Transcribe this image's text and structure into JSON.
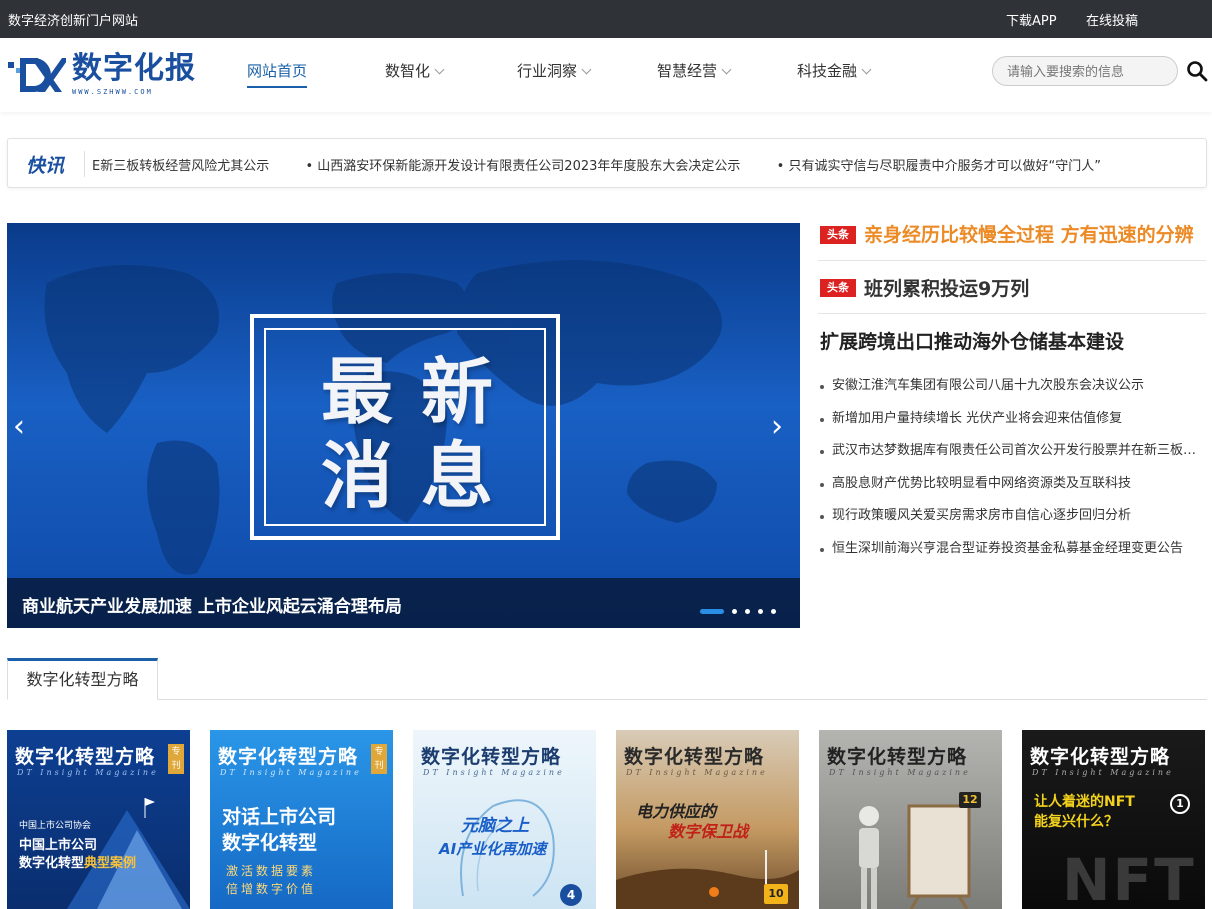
{
  "topbar": {
    "site_desc": "数字经济创新门户网站",
    "download_app": "下载APP",
    "submit_online": "在线投稿"
  },
  "header": {
    "logo_text": "数字化报",
    "logo_url": "WWW.SZHWW.COM",
    "nav": [
      {
        "label": "网站首页",
        "active": true
      },
      {
        "label": "数智化",
        "dropdown": true
      },
      {
        "label": "行业洞察",
        "dropdown": true
      },
      {
        "label": "智慧经营",
        "dropdown": true
      },
      {
        "label": "科技金融",
        "dropdown": true
      }
    ],
    "search_placeholder": "请输入要搜索的信息",
    "search_icon": "search-icon"
  },
  "ticker": {
    "badge": "快讯",
    "items": [
      "E新三板转板经营风险尤其公示",
      "• 山西潞安环保新能源开发设计有限责任公司2023年年度股东大会决定公示",
      "• 只有诚实守信与尽职履责中介服务才可以做好“守门人”"
    ]
  },
  "carousel": {
    "image_text_line1": "最新",
    "image_text_line2": "消息",
    "caption": "商业航天产业发展加速 上市企业风起云涌合理布局",
    "slide_count": 5,
    "active_slide": 1,
    "prev_icon": "‹",
    "next_icon": "›",
    "bg_color": "#0e49a6"
  },
  "headlines": {
    "tag": "头条",
    "top1": "亲身经历比较慢全过程 方有迅速的分辨",
    "top2": "班列累积投运9万列",
    "top3": "扩展跨境出口推动海外仓储基本建设",
    "list": [
      "安徽江淮汽车集团有限公司八届十九次股东会决议公示",
      "新增加用户量持续增长 光伏产业将会迎来估值修复",
      "武汉市达梦数据库有限责任公司首次公开发行股票并在新三板上市",
      "高股息财产优势比较明显看中网络资源类及互联科技",
      "现行政策暖风关爱买房需求房市自信心逐步回归分析",
      "恒生深圳前海兴亨混合型证券投资基金私募基金经理变更公告"
    ],
    "accent_color": "#ec8a25"
  },
  "section": {
    "tab_label": "数字化转型方略"
  },
  "magazines": [
    {
      "title": "数字化转型方略",
      "sub": "DT Insight Magazine",
      "badge": "专刊",
      "line_a": "中国上市公司协会",
      "line_b": "中国上市公司",
      "line_c": "数字化转型",
      "line_c_accent": "典型案例",
      "bg": "#0b3d8c"
    },
    {
      "title": "数字化转型方略",
      "sub": "DT Insight Magazine",
      "badge": "专刊",
      "line_a": "对话上市公司",
      "line_b": "数字化转型",
      "line_c": "激活数据要素",
      "line_d": "倍增数字价值",
      "bg": "#1c7fd6"
    },
    {
      "title": "数字化转型方略",
      "sub": "DT Insight Magazine",
      "line_a": "元脑之上",
      "line_b": "AI产业化再加速",
      "num": "4",
      "bg": "#d7e9f5"
    },
    {
      "title": "数字化转型方略",
      "sub": "DT Insight Magazine",
      "line_a": "电力供应的",
      "line_b": "数字保卫战",
      "num": "10",
      "bg": "#b78b5a"
    },
    {
      "title": "数字化转型方略",
      "sub": "DT Insight Magazine",
      "num": "12",
      "bg": "#8a8a88"
    },
    {
      "title": "数字化转型方略",
      "sub": "DT Insight Magazine",
      "line_a": "让人着迷的NFT",
      "line_b": "能复兴什么？",
      "num": "1",
      "big": "NFT",
      "bg": "#161616"
    }
  ]
}
